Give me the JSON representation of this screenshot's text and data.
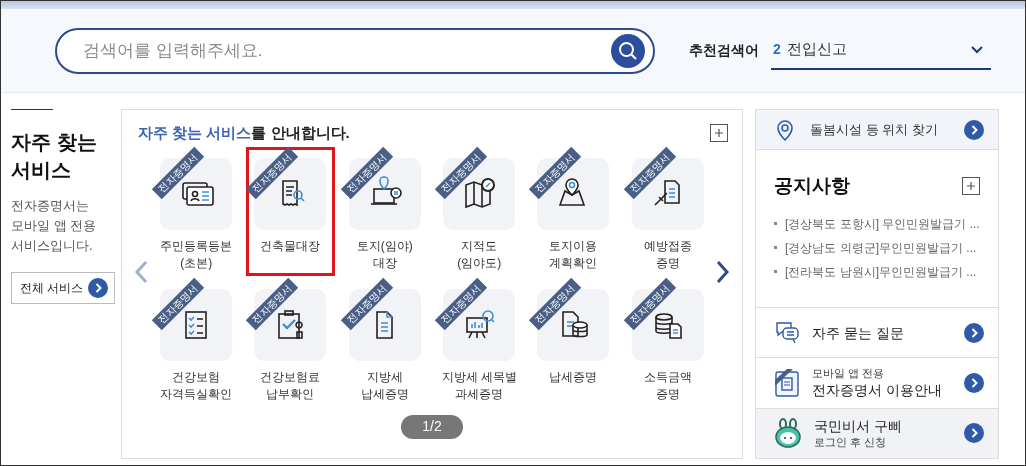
{
  "search": {
    "placeholder": "검색어를 입력해주세요."
  },
  "recommended": {
    "label": "추천검색어",
    "rank": "2",
    "term": "전입신고"
  },
  "left": {
    "title": "자주 찾는\n서비스",
    "description": "전자증명서는\n모바일 앱 전용\n서비스입니다.",
    "button": "전체 서비스"
  },
  "services": {
    "heading": "**자주 찾는 서비스**를 안내합니다.",
    "page": "1/2",
    "items": [
      {
        "label": "주민등록등본\n(초본)",
        "badge": "전자증명서",
        "highlighted": false
      },
      {
        "label": "건축물대장",
        "badge": "전자증명서",
        "highlighted": true
      },
      {
        "label": "토지(임야)\n대장",
        "badge": "전자증명서",
        "highlighted": false
      },
      {
        "label": "지적도\n(임야도)",
        "badge": "전자증명서",
        "highlighted": false
      },
      {
        "label": "토지이용\n계획확인",
        "badge": "전자증명서",
        "highlighted": false
      },
      {
        "label": "예방접종\n증명",
        "badge": "전자증명서",
        "highlighted": false
      },
      {
        "label": "건강보험\n자격득실확인",
        "badge": "전자증명서",
        "highlighted": false
      },
      {
        "label": "건강보험료\n납부확인",
        "badge": "전자증명서",
        "highlighted": false
      },
      {
        "label": "지방세\n납세증명",
        "badge": "전자증명서",
        "highlighted": false
      },
      {
        "label": "지방세 세목별\n과세증명",
        "badge": "전자증명서",
        "highlighted": false
      },
      {
        "label": "납세증명",
        "badge": "전자증명서",
        "highlighted": false
      },
      {
        "label": "소득금액\n증명",
        "badge": "전자증명서",
        "highlighted": false
      }
    ]
  },
  "right": {
    "location": "돌봄시설 등 위치 찾기",
    "notices": {
      "title": "공지사항",
      "items": [
        "[경상북도 포항시] 무인민원발급기 ...",
        "[경상남도 의령군]무인민원발급기 ...",
        "[전라북도 남원시]무인민원발급기 ..."
      ]
    },
    "links": [
      {
        "kind": "faq",
        "title": "자주 묻는 질문"
      },
      {
        "kind": "app",
        "subtitle": "모바일 앱 전용",
        "title": "전자증명서 이용안내"
      },
      {
        "kind": "assistant",
        "title": "국민비서 구삐",
        "subtitle": "로그인 후 신청"
      }
    ]
  }
}
